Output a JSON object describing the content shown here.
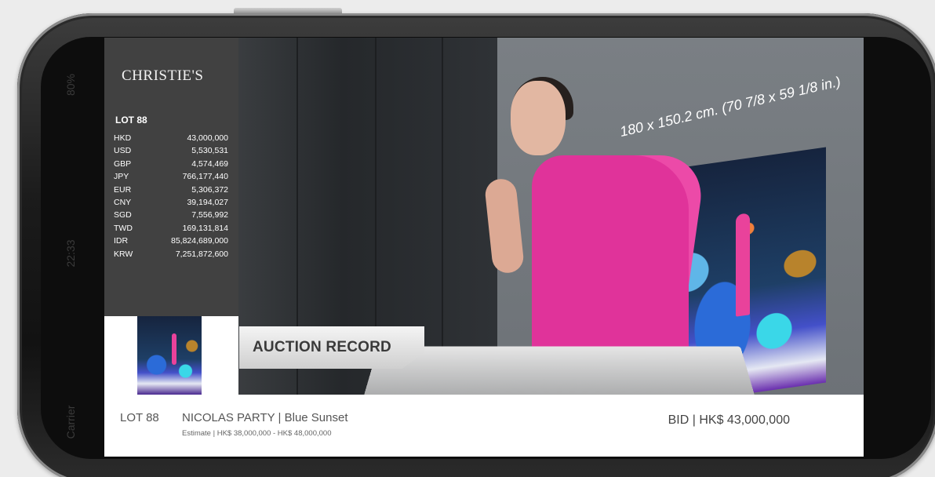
{
  "brand": "CHRISTIE'S",
  "lot_label": "LOT 88",
  "rates": [
    {
      "currency": "HKD",
      "amount": "43,000,000"
    },
    {
      "currency": "USD",
      "amount": "5,530,531"
    },
    {
      "currency": "GBP",
      "amount": "4,574,469"
    },
    {
      "currency": "JPY",
      "amount": "766,177,440"
    },
    {
      "currency": "EUR",
      "amount": "5,306,372"
    },
    {
      "currency": "CNY",
      "amount": "39,194,027"
    },
    {
      "currency": "SGD",
      "amount": "7,556,992"
    },
    {
      "currency": "TWD",
      "amount": "169,131,814"
    },
    {
      "currency": "IDR",
      "amount": "85,824,689,000"
    },
    {
      "currency": "KRW",
      "amount": "7,251,872,600"
    }
  ],
  "record_tag": "AUCTION RECORD",
  "painting_dimensions": "180 x 150.2 cm. (70 7/8 x 59 1/8 in.)",
  "lower_bar": {
    "lot": "LOT 88",
    "artist_title": "NICOLAS PARTY  | Blue Sunset",
    "estimate": "Estimate | HK$ 38,000,000 - HK$ 48,000,000",
    "bid": "BID | HK$ 43,000,000"
  },
  "status_bar": {
    "time": "22:33",
    "carrier": "Carrier",
    "battery": "80%"
  },
  "colors": {
    "panel": "#3c3c3c",
    "dress": "#e0339a",
    "lower_bar": "#ffffff"
  }
}
